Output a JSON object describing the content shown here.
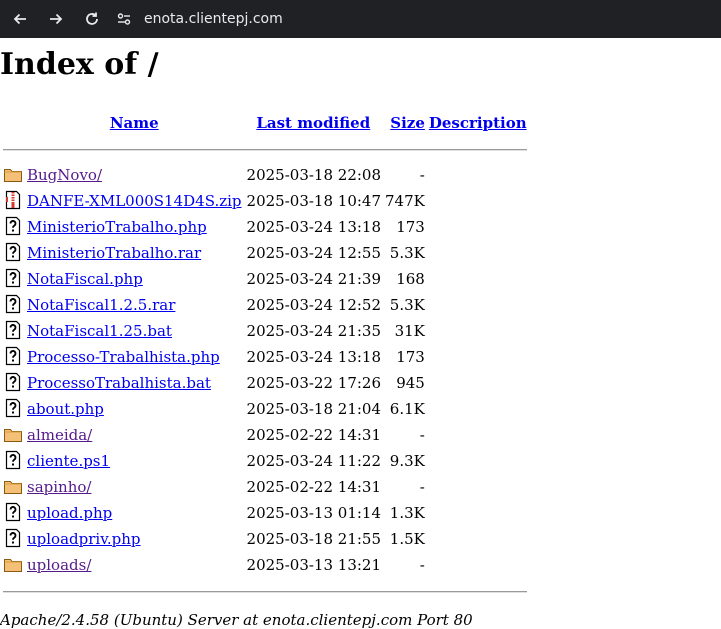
{
  "browser": {
    "url": "enota.clientepj.com"
  },
  "page": {
    "title": "Index of /",
    "columns": {
      "name": "Name",
      "last_modified": "Last modified",
      "size": "Size",
      "description": "Description"
    },
    "rows": [
      {
        "name": "BugNovo/",
        "modified": "2025-03-18 22:08",
        "size": "-",
        "icon": "folder-icon",
        "visited": true
      },
      {
        "name": "DANFE-XML000S14D4S.zip",
        "modified": "2025-03-18 10:47",
        "size": "747K",
        "icon": "compressed-file-icon",
        "visited": false
      },
      {
        "name": "MinisterioTrabalho.php",
        "modified": "2025-03-24 13:18",
        "size": "173",
        "icon": "unknown-file-icon",
        "visited": false
      },
      {
        "name": "MinisterioTrabalho.rar",
        "modified": "2025-03-24 12:55",
        "size": "5.3K",
        "icon": "unknown-file-icon",
        "visited": false
      },
      {
        "name": "NotaFiscal.php",
        "modified": "2025-03-24 21:39",
        "size": "168",
        "icon": "unknown-file-icon",
        "visited": false
      },
      {
        "name": "NotaFiscal1.2.5.rar",
        "modified": "2025-03-24 12:52",
        "size": "5.3K",
        "icon": "unknown-file-icon",
        "visited": false
      },
      {
        "name": "NotaFiscal1.25.bat",
        "modified": "2025-03-24 21:35",
        "size": "31K",
        "icon": "unknown-file-icon",
        "visited": false
      },
      {
        "name": "Processo-Trabalhista.php",
        "modified": "2025-03-24 13:18",
        "size": "173",
        "icon": "unknown-file-icon",
        "visited": false
      },
      {
        "name": "ProcessoTrabalhista.bat",
        "modified": "2025-03-22 17:26",
        "size": "945",
        "icon": "unknown-file-icon",
        "visited": false
      },
      {
        "name": "about.php",
        "modified": "2025-03-18 21:04",
        "size": "6.1K",
        "icon": "unknown-file-icon",
        "visited": false
      },
      {
        "name": "almeida/",
        "modified": "2025-02-22 14:31",
        "size": "-",
        "icon": "folder-icon",
        "visited": true
      },
      {
        "name": "cliente.ps1",
        "modified": "2025-03-24 11:22",
        "size": "9.3K",
        "icon": "unknown-file-icon",
        "visited": false
      },
      {
        "name": "sapinho/",
        "modified": "2025-02-22 14:31",
        "size": "-",
        "icon": "folder-icon",
        "visited": true
      },
      {
        "name": "upload.php",
        "modified": "2025-03-13 01:14",
        "size": "1.3K",
        "icon": "unknown-file-icon",
        "visited": false
      },
      {
        "name": "uploadpriv.php",
        "modified": "2025-03-18 21:55",
        "size": "1.5K",
        "icon": "unknown-file-icon",
        "visited": false
      },
      {
        "name": "uploads/",
        "modified": "2025-03-13 13:21",
        "size": "-",
        "icon": "folder-icon",
        "visited": true
      }
    ],
    "footer": "Apache/2.4.58 (Ubuntu) Server at enota.clientepj.com Port 80"
  }
}
